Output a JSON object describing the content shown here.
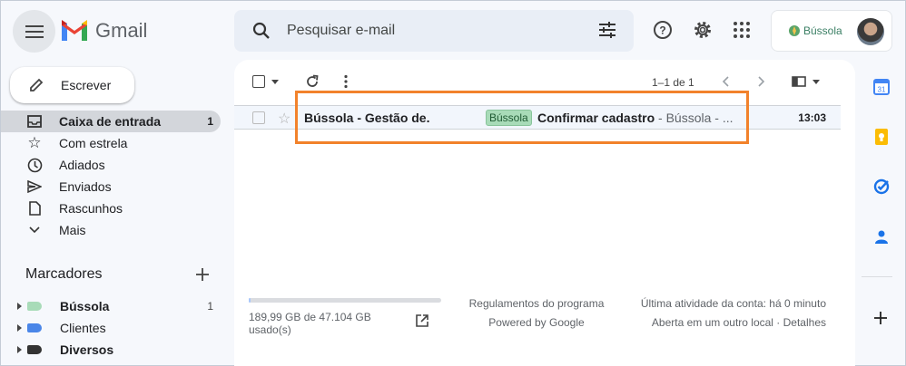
{
  "app": {
    "name": "Gmail"
  },
  "search": {
    "placeholder": "Pesquisar e-mail"
  },
  "account": {
    "org_name": "Bússola"
  },
  "compose": {
    "label": "Escrever"
  },
  "nav": [
    {
      "label": "Caixa de entrada",
      "count": "1",
      "icon": "inbox-icon",
      "active": true
    },
    {
      "label": "Com estrela",
      "icon": "star-icon"
    },
    {
      "label": "Adiados",
      "icon": "clock-icon"
    },
    {
      "label": "Enviados",
      "icon": "send-icon"
    },
    {
      "label": "Rascunhos",
      "icon": "draft-icon"
    },
    {
      "label": "Mais",
      "icon": "chevron-down-icon"
    }
  ],
  "labels": {
    "title": "Marcadores",
    "items": [
      {
        "name": "Bússola",
        "count": "1",
        "color": "#a8dbb8",
        "bold": true
      },
      {
        "name": "Clientes",
        "color": "#4a86e8",
        "bold": false
      },
      {
        "name": "Diversos",
        "color": "#333333",
        "bold": true
      }
    ]
  },
  "toolbar": {
    "pager": "1–1 de 1"
  },
  "email": {
    "sender": "Bússola - Gestão de.",
    "label_chip": "Bússola",
    "subject": "Confirmar cadastro",
    "snippet": " - Bússola - ...",
    "time": "13:03"
  },
  "footer": {
    "storage": "189,99 GB de 47.104 GB usado(s)",
    "storage_used_fraction": 0.004,
    "terms": "Regulamentos do programa",
    "powered": "Powered by Google",
    "activity": "Última atividade da conta: há 0 minuto",
    "details": "Aberta em um outro local · Detalhes"
  },
  "colors": {
    "accent_highlight": "#f2822b",
    "label_green": "#a8dbb8"
  }
}
